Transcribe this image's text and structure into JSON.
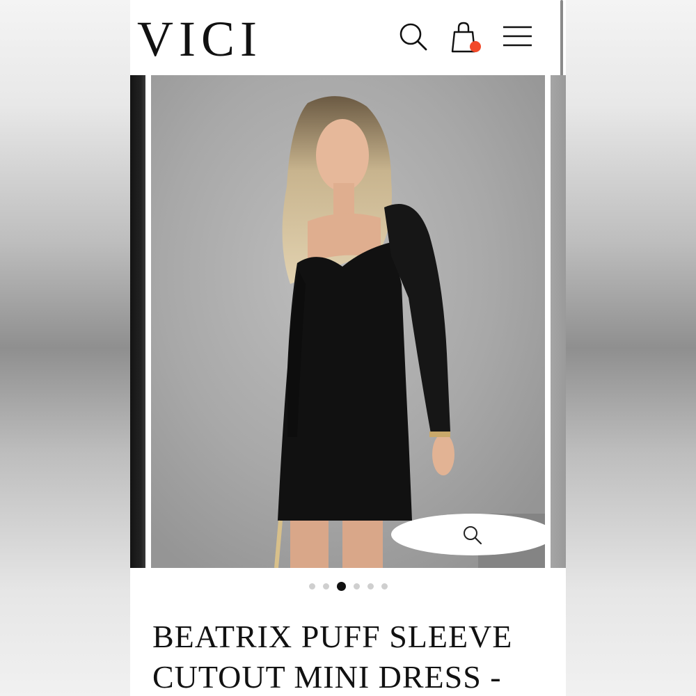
{
  "header": {
    "logo_text": "VICI",
    "icons": [
      "search-icon",
      "shopping-bag-icon",
      "hamburger-menu-icon"
    ],
    "cart_badge_color": "#f24a2a"
  },
  "gallery": {
    "image_description": "",
    "slide_count": 6,
    "active_slide": 3,
    "zoom_icon": "search-icon"
  },
  "product": {
    "title_line1": "BEATRIX PUFF SLEEVE",
    "title_line2": "CUTOUT MINI DRESS -"
  }
}
